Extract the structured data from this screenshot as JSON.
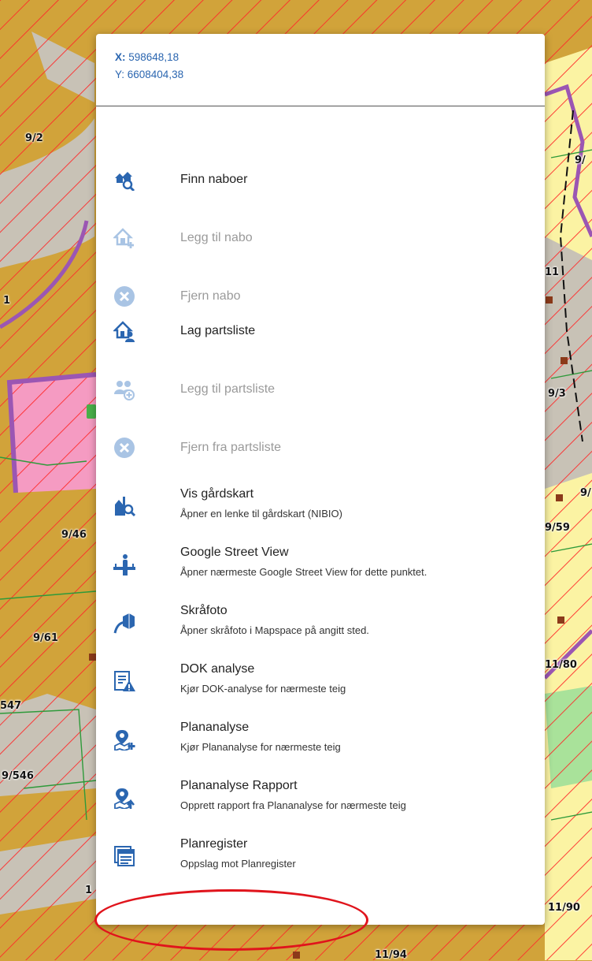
{
  "map": {
    "labels": [
      "9/2",
      "1",
      "9/46",
      "9/61",
      "547",
      "9/546",
      "1",
      "11/94",
      "9/",
      "11",
      "9/3",
      "9/",
      "9/59",
      "11/80",
      "11/90"
    ]
  },
  "coords": {
    "x_label": "X:",
    "x_value": "598648,18",
    "y_label": "Y: 6608404,38"
  },
  "menu": {
    "items": [
      {
        "title": "Finn naboer",
        "subtitle": "",
        "icon": "find-neighbors-icon",
        "enabled": true
      },
      {
        "title": "Legg til nabo",
        "subtitle": "",
        "icon": "add-neighbor-icon",
        "enabled": false
      },
      {
        "title": "Fjern nabo",
        "subtitle": "",
        "icon": "remove-icon",
        "enabled": false
      },
      {
        "title": "Lag partsliste",
        "subtitle": "",
        "icon": "party-list-icon",
        "enabled": true
      },
      {
        "title": "Legg til partsliste",
        "subtitle": "",
        "icon": "add-party-icon",
        "enabled": false
      },
      {
        "title": "Fjern fra partsliste",
        "subtitle": "",
        "icon": "remove-icon",
        "enabled": false
      },
      {
        "title": "Vis gårdskart",
        "subtitle": "Åpner en lenke til gårdskart (NIBIO)",
        "icon": "farm-map-icon",
        "enabled": true
      },
      {
        "title": "Google Street View",
        "subtitle": "Åpner nærmeste Google Street View for dette punktet.",
        "icon": "street-view-icon",
        "enabled": true
      },
      {
        "title": "Skråfoto",
        "subtitle": "Åpner skråfoto i Mapspace på angitt sted.",
        "icon": "oblique-photo-icon",
        "enabled": true
      },
      {
        "title": "DOK analyse",
        "subtitle": "Kjør DOK-analyse for nærmeste teig",
        "icon": "dok-analysis-icon",
        "enabled": true
      },
      {
        "title": "Plananalyse",
        "subtitle": "Kjør Plananalyse for nærmeste teig",
        "icon": "plan-analysis-icon",
        "enabled": true
      },
      {
        "title": "Plananalyse Rapport",
        "subtitle": "Opprett rapport fra Plananalyse for nærmeste teig",
        "icon": "plan-report-icon",
        "enabled": true
      },
      {
        "title": "Planregister",
        "subtitle": "Oppslag mot Planregister",
        "icon": "plan-register-icon",
        "enabled": true
      }
    ]
  },
  "colors": {
    "accent": "#2b66b0",
    "icon_enabled": "#2b66b0",
    "icon_disabled": "#a9c4e4",
    "highlight": "#e0141c",
    "map_orange": "#d1a33a",
    "map_gray": "#c8c2b6",
    "map_yellow": "#fbf3a3",
    "map_pink": "#f59bc2",
    "map_hatch": "#ff2a2a",
    "map_purple": "#9b56b3"
  }
}
